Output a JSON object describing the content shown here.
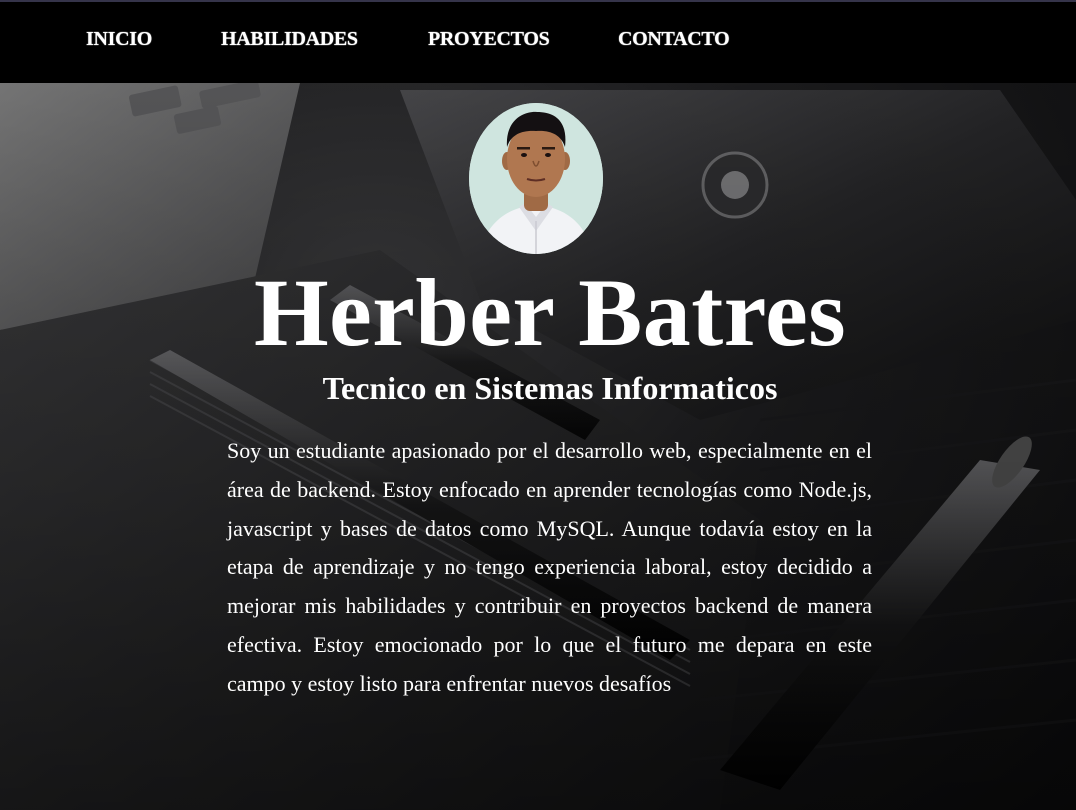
{
  "nav": {
    "items": [
      {
        "label": "INICIO"
      },
      {
        "label": "HABILIDADES"
      },
      {
        "label": "PROYECTOS"
      },
      {
        "label": "CONTACTO"
      }
    ]
  },
  "hero": {
    "name": "Herber Batres",
    "subtitle": "Tecnico en Sistemas Informaticos",
    "bio": "Soy un estudiante apasionado por el desarrollo web, especialmente en el área de backend. Estoy enfocado en aprender tecnologías como Node.js, javascript y bases de datos como MySQL. Aunque todavía estoy en la etapa de aprendizaje y no tengo experiencia laboral, estoy decidido a mejorar mis habilidades y contribuir en proyectos backend de manera efectiva. Estoy emocionado por lo que el futuro me depara en este campo y estoy listo para enfrentar nuevos desafíos"
  },
  "images": {
    "avatar": "profile-photo",
    "background": "desk-notebook-pens-phone-photo"
  },
  "colors": {
    "nav_background": "#000000",
    "text": "#ffffff",
    "avatar_background": "#cfe5df"
  }
}
